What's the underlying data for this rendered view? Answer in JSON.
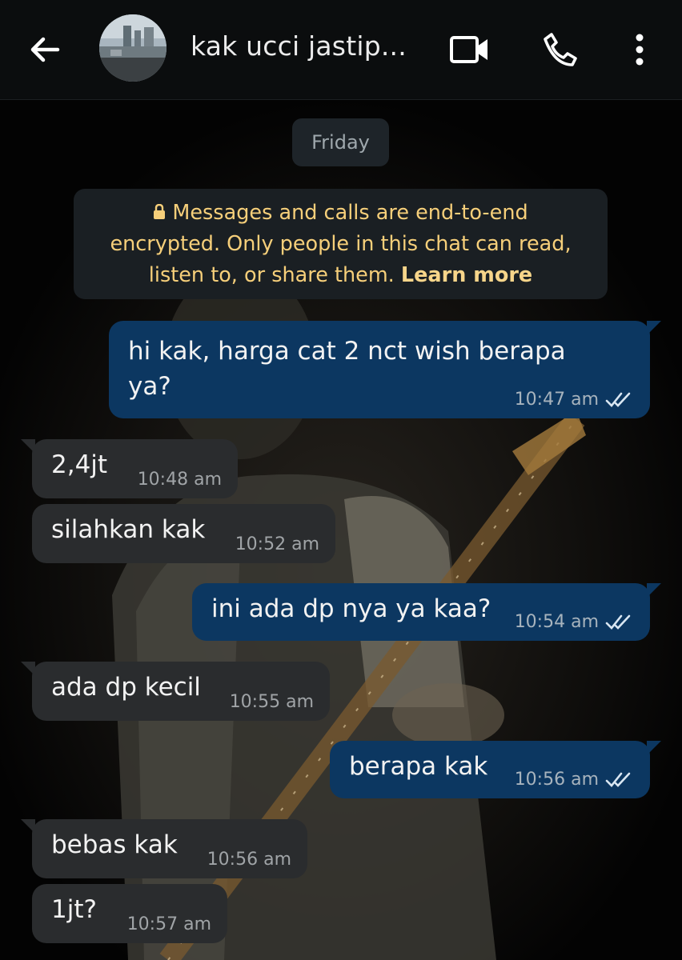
{
  "header": {
    "contact_name": "kak ucci jastip...",
    "back_icon": "arrow-left-icon",
    "video_icon": "video-call-icon",
    "call_icon": "phone-icon",
    "menu_icon": "more-vert-icon"
  },
  "chat": {
    "date_label": "Friday",
    "encryption_notice": {
      "line1": "Messages and calls are end-to-end",
      "line2": "encrypted. Only people in this chat can read,",
      "line3_prefix": "listen to, or share them. ",
      "learn_more": "Learn more"
    },
    "messages": [
      {
        "direction": "out",
        "line1": "hi kak, harga cat 2 nct wish berapa",
        "line2": "ya?",
        "time": "10:47 am",
        "status": "read"
      },
      {
        "direction": "in",
        "text": "2,4jt",
        "time": "10:48 am"
      },
      {
        "direction": "in",
        "text": "silahkan kak",
        "time": "10:52 am"
      },
      {
        "direction": "out",
        "text": "ini ada dp nya ya kaa?",
        "time": "10:54 am",
        "status": "read"
      },
      {
        "direction": "in",
        "text": "ada dp kecil",
        "time": "10:55 am"
      },
      {
        "direction": "out",
        "text": "berapa kak",
        "time": "10:56 am",
        "status": "read"
      },
      {
        "direction": "in",
        "text": "bebas kak",
        "time": "10:56 am"
      },
      {
        "direction": "in",
        "text": "1jt?",
        "time": "10:57 am"
      }
    ]
  },
  "colors": {
    "outgoing_bubble": "#0c3761",
    "incoming_bubble": "#2a2c2e",
    "notice_text": "#f6cf7a",
    "read_ticks": "#d9e6f2"
  }
}
